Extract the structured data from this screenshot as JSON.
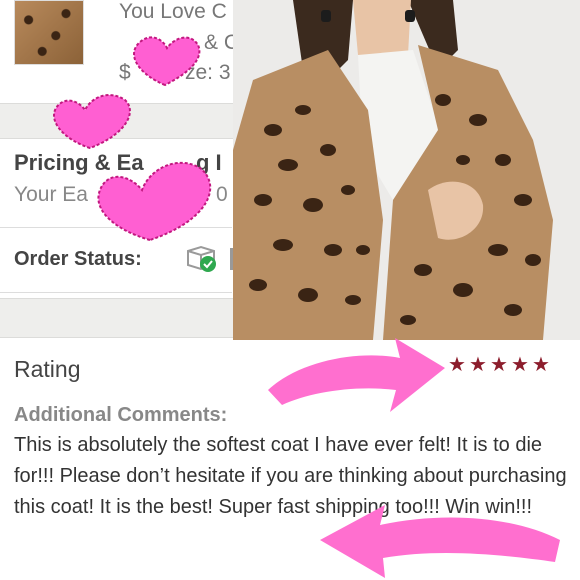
{
  "order": {
    "title_fragment": "You Love C",
    "line2_fragment": "& C",
    "line3_fragment": "$",
    "size_fragment": "ze: 3"
  },
  "pricing": {
    "title_fragment": "Pricing & Ea",
    "title_fragment2": "g I",
    "earnings_fragment": "Your Ea",
    "earnings_fragment2": "0"
  },
  "order_status": {
    "label": "Order Status:"
  },
  "rating": {
    "label": "Rating",
    "value": 5,
    "max": 5,
    "star_color": "#8c1d2c"
  },
  "comments": {
    "title": "Additional Comments:",
    "text": "This is absolutely the softest coat I have ever felt! It is to die for!!! Please don’t hesitate if you are thinking about purchasing this coat! It is the best! Super fast shipping too!!! Win win!!!"
  },
  "decorations": {
    "heart_color": "#ff5fd2",
    "arrow_color": "#ff6fcf"
  }
}
